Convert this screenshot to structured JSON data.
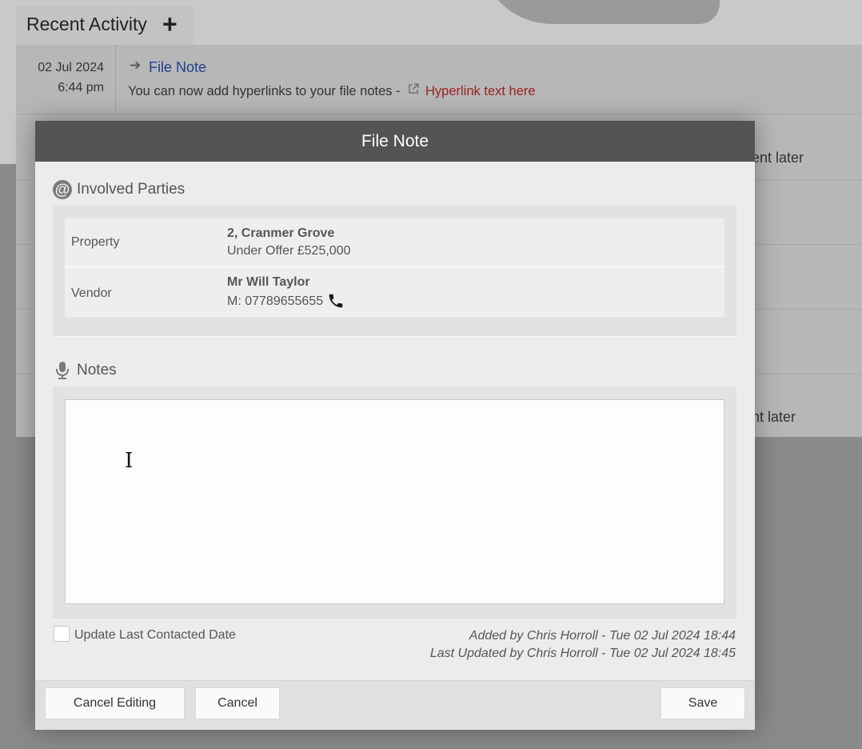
{
  "recent_activity": {
    "title": "Recent Activity",
    "add_label": "+",
    "item": {
      "date": "02 Jul 2024",
      "time": "6:44 pm",
      "arrow": "➔",
      "title": "File Note",
      "description": "You can now add hyperlinks to your file notes -",
      "link_text": "Hyperlink text here"
    },
    "partial_row_text_1": "ent later",
    "partial_row_text_2": "nt later"
  },
  "modal": {
    "title": "File Note",
    "involved_parties": {
      "heading": "Involved Parties",
      "rows": [
        {
          "label": "Property",
          "name": "2, Cranmer Grove",
          "detail": "Under Offer £525,000"
        },
        {
          "label": "Vendor",
          "name": "Mr Will Taylor",
          "detail": "M: 07789655655"
        }
      ]
    },
    "notes": {
      "heading": "Notes",
      "value": "",
      "placeholder": ""
    },
    "update_last_contacted": {
      "label": "Update Last Contacted Date",
      "checked": false
    },
    "added_by": "Added by Chris Horroll - Tue 02 Jul 2024 18:44",
    "last_updated_by": "Last Updated by Chris Horroll - Tue 02 Jul 2024 18:45",
    "buttons": {
      "cancel_editing": "Cancel Editing",
      "cancel": "Cancel",
      "save": "Save"
    }
  },
  "icons": {
    "parties": "at-icon",
    "notes": "microphone-icon",
    "phone": "phone-icon",
    "external_link": "external-link-icon",
    "text_cursor": "text-cursor-icon"
  }
}
